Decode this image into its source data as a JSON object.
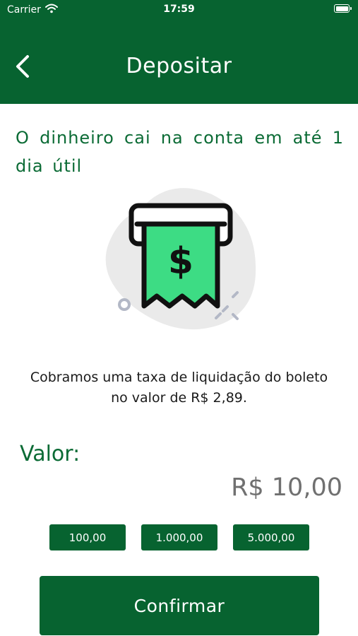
{
  "status_bar": {
    "carrier": "Carrier",
    "time": "17:59"
  },
  "nav": {
    "title": "Depositar",
    "back_icon": "chevron-left-icon"
  },
  "intro": {
    "text": "O dinheiro cai na conta em até 1 dia útil"
  },
  "illustration": {
    "icon": "boleto-receipt-dollar-icon"
  },
  "fee": {
    "line1": "Cobramos uma taxa de liquidação do boleto",
    "line2": "no valor de R$ 2,89."
  },
  "value": {
    "label": "Valor:",
    "amount": "R$ 10,00"
  },
  "quick_amounts": [
    "100,00",
    "1.000,00",
    "5.000,00"
  ],
  "actions": {
    "confirm_label": "Confirmar"
  },
  "colors": {
    "brand_green": "#076330",
    "text_green": "#0b6b35",
    "receipt_green": "#3ddc84",
    "amount_gray": "#707070"
  }
}
